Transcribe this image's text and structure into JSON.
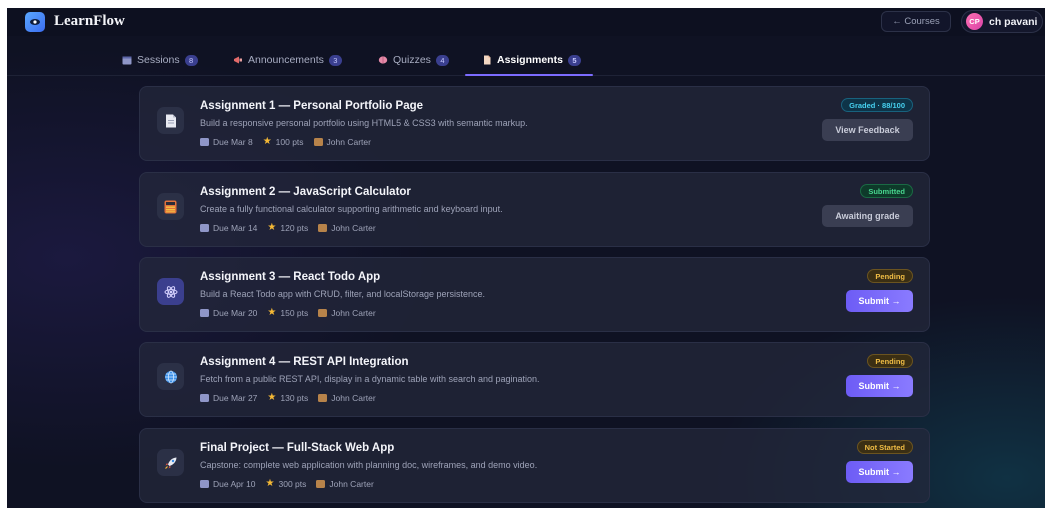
{
  "app": {
    "title": "LearnFlow"
  },
  "header": {
    "courses_label": "← Courses",
    "user_initials": "CP",
    "user_name": "ch pavani"
  },
  "tabs": [
    {
      "label": "Sessions",
      "count": "8",
      "icon": "calendar-icon"
    },
    {
      "label": "Announcements",
      "count": "3",
      "icon": "megaphone-icon"
    },
    {
      "label": "Quizzes",
      "count": "4",
      "icon": "brain-icon"
    },
    {
      "label": "Assignments",
      "count": "5",
      "icon": "document-icon",
      "active": true
    }
  ],
  "assignments": [
    {
      "title": "Assignment 1 — Personal Portfolio Page",
      "description": "Build a responsive personal portfolio using HTML5 & CSS3 with semantic markup.",
      "due": "Due Mar 8",
      "points": "100 pts",
      "instructor": "John Carter",
      "status": "Graded · 88/100",
      "action": "View Feedback",
      "icon": "document-icon"
    },
    {
      "title": "Assignment 2 — JavaScript Calculator",
      "description": "Create a fully functional calculator supporting arithmetic and keyboard input.",
      "due": "Due Mar 14",
      "points": "120 pts",
      "instructor": "John Carter",
      "status": "Submitted",
      "action": "Awaiting grade",
      "icon": "calculator-icon"
    },
    {
      "title": "Assignment 3 — React Todo App",
      "description": "Build a React Todo app with CRUD, filter, and localStorage persistence.",
      "due": "Due Mar 20",
      "points": "150 pts",
      "instructor": "John Carter",
      "status": "Pending",
      "action": "Submit →",
      "icon": "atom-icon"
    },
    {
      "title": "Assignment 4 — REST API Integration",
      "description": "Fetch from a public REST API, display in a dynamic table with search and pagination.",
      "due": "Due Mar 27",
      "points": "130 pts",
      "instructor": "John Carter",
      "status": "Pending",
      "action": "Submit →",
      "icon": "globe-icon"
    },
    {
      "title": "Final Project — Full-Stack Web App",
      "description": "Capstone: complete web application with planning doc, wireframes, and demo video.",
      "due": "Due Apr 10",
      "points": "300 pts",
      "instructor": "John Carter",
      "status": "Not Started",
      "action": "Submit →",
      "icon": "rocket-icon"
    }
  ],
  "colors": {
    "background": "#0f1223",
    "accent": "#7c6cff",
    "graded": "#46d0ef",
    "submitted": "#48d58e",
    "pending": "#f0bd45"
  }
}
